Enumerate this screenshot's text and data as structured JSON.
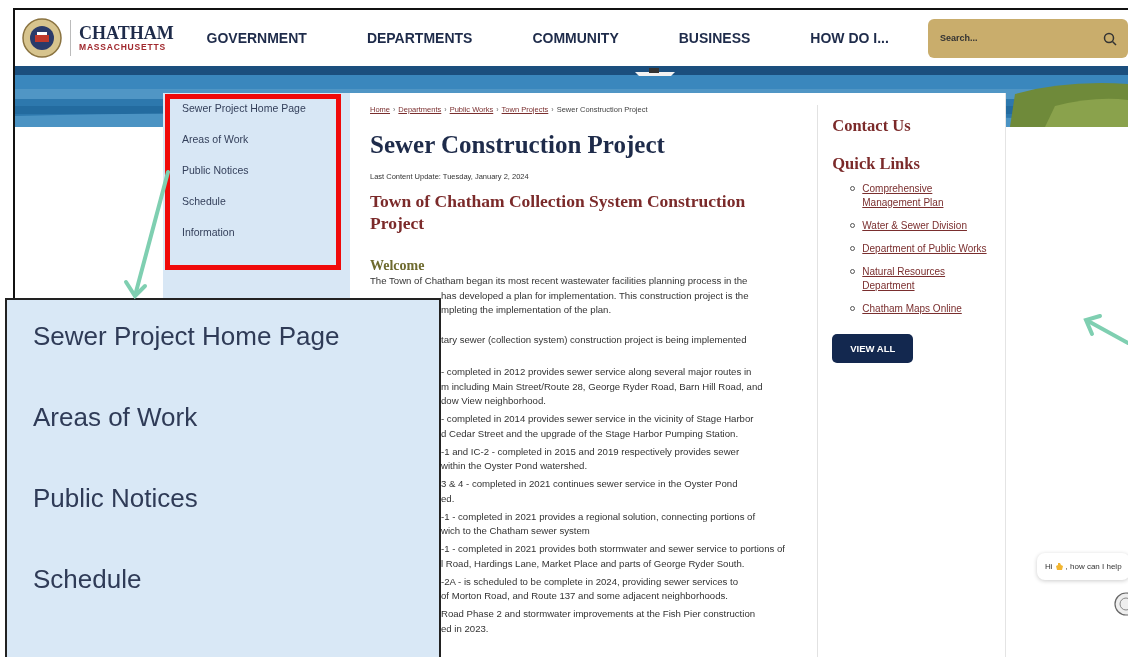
{
  "header": {
    "logo": {
      "name": "CHATHAM",
      "subtitle": "MASSACHUSETTS"
    },
    "nav": [
      {
        "label": "GOVERNMENT"
      },
      {
        "label": "DEPARTMENTS"
      },
      {
        "label": "COMMUNITY"
      },
      {
        "label": "BUSINESS"
      },
      {
        "label": "HOW DO I..."
      }
    ],
    "search": {
      "placeholder": "Search..."
    }
  },
  "side_nav": {
    "items": [
      {
        "label": "Sewer Project Home Page"
      },
      {
        "label": "Areas of Work"
      },
      {
        "label": "Public Notices"
      },
      {
        "label": "Schedule"
      },
      {
        "label": "Information"
      }
    ]
  },
  "breadcrumb": [
    {
      "label": "Home",
      "link": true
    },
    {
      "separator": "›",
      "label": "Departments",
      "link": true
    },
    {
      "separator": "›",
      "label": "Public Works",
      "link": true
    },
    {
      "separator": "›",
      "label": "Town Projects",
      "link": true
    },
    {
      "separator": "›",
      "label": "Sewer Construction Project",
      "link": false
    }
  ],
  "title": "Sewer Construction Project",
  "last_update": "Last Content Update: Tuesday, January 2, 2024",
  "subtitle": "Town of Chatham Collection System Construction Project",
  "welcome": {
    "heading": "Welcome",
    "intro": "The Town of Chatham began its most recent wastewater facilities planning process in the",
    "fragments": [
      [
        "has developed a plan for implementation. This construction project is the",
        "mpleting the implementation of the plan."
      ],
      [
        "tary sewer (collection system) construction project is being implemented"
      ],
      [
        "- completed in 2012 provides sewer service along several major routes in",
        "m including Main Street/Route 28, George Ryder Road, Barn Hill Road, and",
        "dow View neighborhood."
      ],
      [
        "- completed in 2014 provides sewer service in the vicinity of Stage Harbor",
        "d Cedar Street and the upgrade of the Stage Harbor Pumping Station."
      ],
      [
        "-1 and IC-2 - completed in 2015 and 2019 respectively provides sewer",
        "within the Oyster Pond watershed."
      ],
      [
        "3 & 4 - completed in 2021 continues sewer service in the Oyster Pond",
        "ed."
      ],
      [
        "-1 - completed in 2021 provides a regional solution, connecting portions of",
        "wich to the Chatham sewer system"
      ],
      [
        "-1 - completed in 2021 provides both stormwater and sewer service to portions of",
        "l Road, Hardings Lane, Market Place and parts of George Ryder South."
      ],
      [
        "-2A - is scheduled to be complete in 2024, providing sewer services to",
        "of Morton Road, and Route 137 and some adjacent neighborhoods."
      ],
      [
        "Road Phase 2 and stormwater improvements at the Fish Pier construction",
        "ed in 2023."
      ]
    ]
  },
  "sidebar": {
    "contact_heading": "Contact Us",
    "quick_links_heading": "Quick Links",
    "links": [
      {
        "label": "Comprehensive Management Plan"
      },
      {
        "label": "Water & Sewer Division"
      },
      {
        "label": "Department of Public Works"
      },
      {
        "label": "Natural Resources Department"
      },
      {
        "label": "Chatham Maps Online"
      }
    ],
    "button": "VIEW ALL"
  },
  "zoom_callout": {
    "items": [
      {
        "label": "Sewer Project Home Page"
      },
      {
        "label": "Areas of Work"
      },
      {
        "label": "Public Notices"
      },
      {
        "label": "Schedule"
      }
    ]
  },
  "chat": {
    "greeting": "Hi",
    "message": ", how can I help"
  }
}
